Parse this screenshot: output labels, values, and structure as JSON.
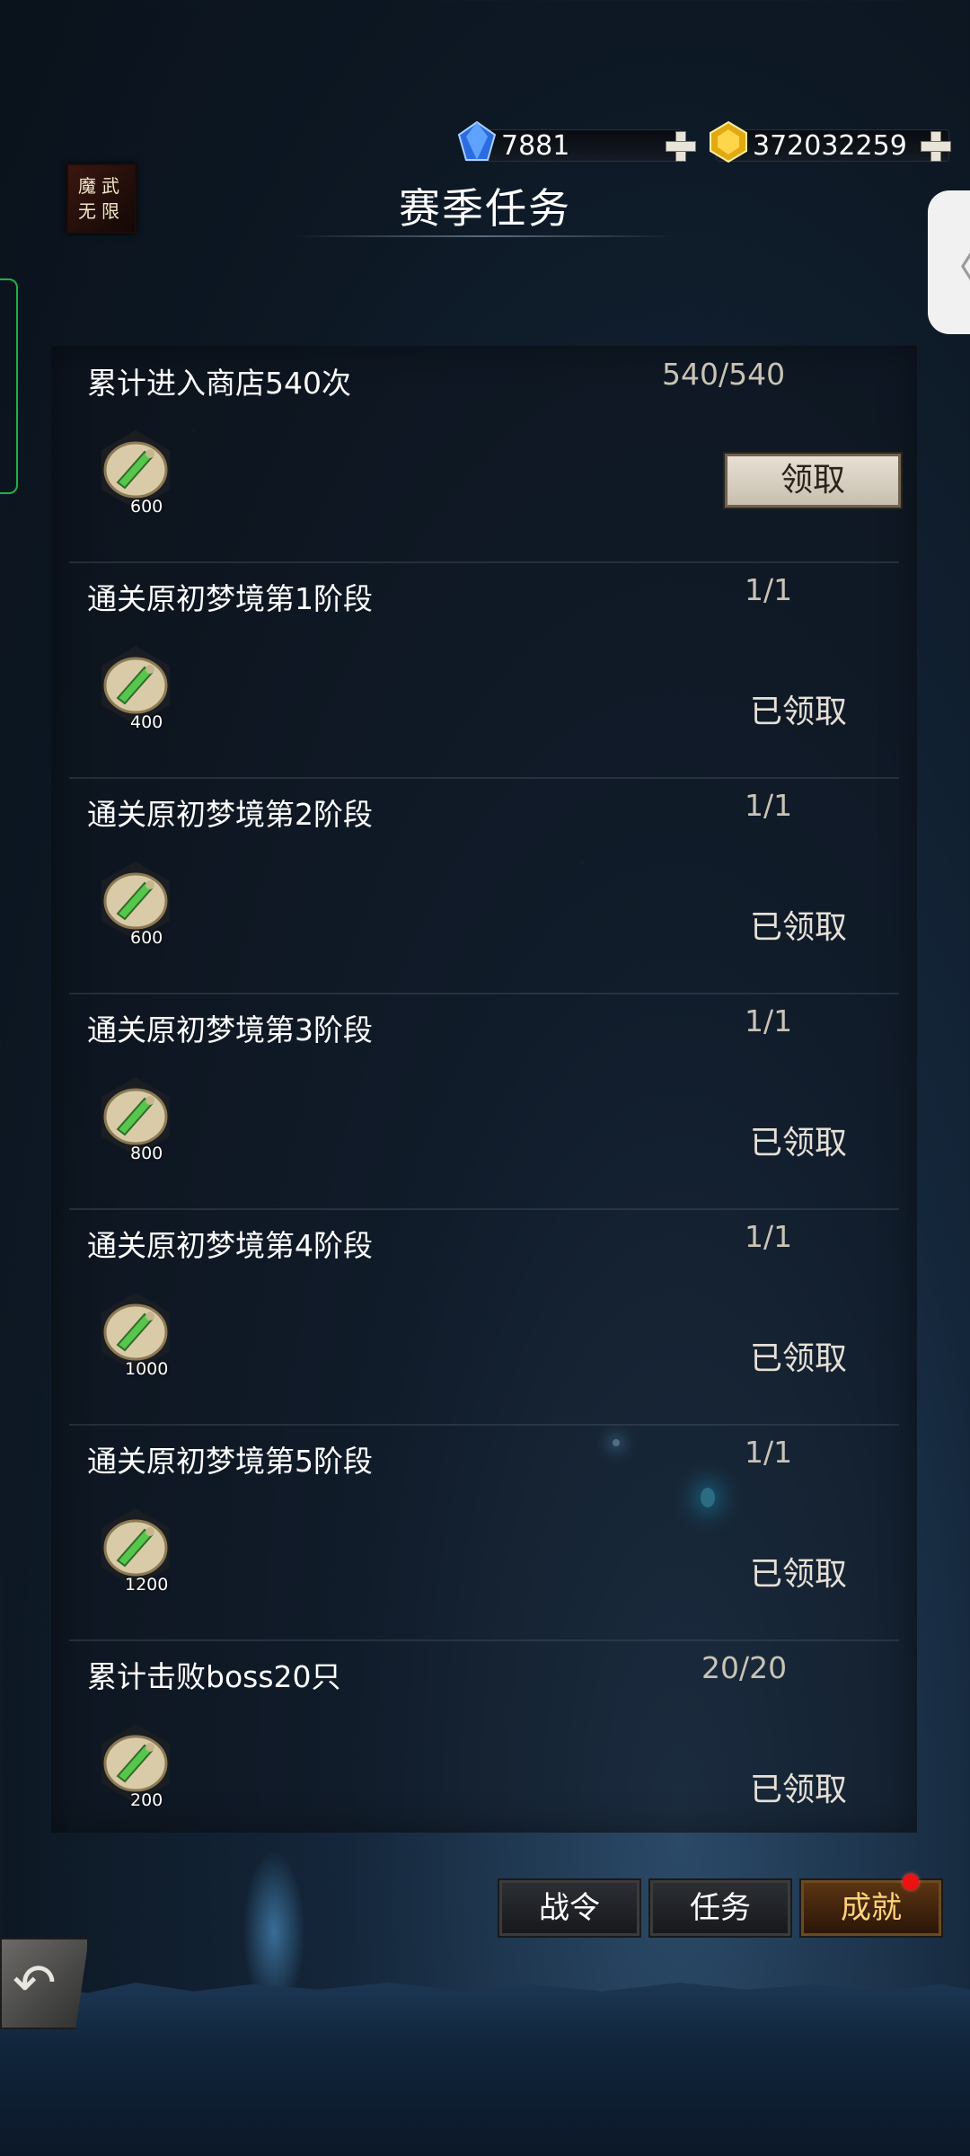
{
  "header": {
    "title": "赛季任务",
    "logo_text": "魔武无限"
  },
  "currencies": [
    {
      "icon": "blue-diamond-icon",
      "value": "7881"
    },
    {
      "icon": "gold-diamond-icon",
      "value": "372032259"
    }
  ],
  "tasks": [
    {
      "name": "累计进入商店540次",
      "progress": "540/540",
      "reward_count": "600",
      "status": "领取",
      "claimable": true
    },
    {
      "name": "通关原初梦境第1阶段",
      "progress": "1/1",
      "reward_count": "400",
      "status": "已领取",
      "claimable": false
    },
    {
      "name": "通关原初梦境第2阶段",
      "progress": "1/1",
      "reward_count": "600",
      "status": "已领取",
      "claimable": false
    },
    {
      "name": "通关原初梦境第3阶段",
      "progress": "1/1",
      "reward_count": "800",
      "status": "已领取",
      "claimable": false
    },
    {
      "name": "通关原初梦境第4阶段",
      "progress": "1/1",
      "reward_count": "1000",
      "status": "已领取",
      "claimable": false
    },
    {
      "name": "通关原初梦境第5阶段",
      "progress": "1/1",
      "reward_count": "1200",
      "status": "已领取",
      "claimable": false
    },
    {
      "name": "累计击败boss20只",
      "progress": "20/20",
      "reward_count": "200",
      "status": "已领取",
      "claimable": false
    }
  ],
  "tabs": [
    {
      "label": "战令",
      "active": false
    },
    {
      "label": "任务",
      "active": false
    },
    {
      "label": "成就",
      "active": true,
      "notification": true
    }
  ],
  "colors": {
    "accent_gold": "#ffd27a",
    "notification_red": "#ee1111",
    "claim_button_bg": "#e7e0d3"
  }
}
